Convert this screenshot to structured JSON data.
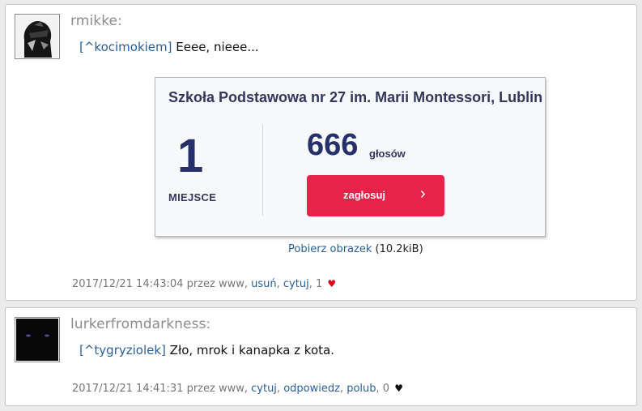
{
  "posts": [
    {
      "username": "rmikke:",
      "text_link": "[^kocimokiem]",
      "text": " Eeee, nieee...",
      "card": {
        "title": "Szkoła Podstawowa nr 27 im. Marii Montessori, Lublin",
        "rank": "1",
        "rank_label": "MIEJSCE",
        "votes": "666",
        "votes_label": "głosów",
        "button_label": "zagłosuj",
        "accent": "#e8234a"
      },
      "download_link": "Pobierz obrazek",
      "download_size": " (10.2kiB)",
      "meta_prefix": "2017/12/21 14:43:04 przez www, ",
      "actions": [
        "usuń",
        "cytuj"
      ],
      "likes": "1",
      "heart_color": "#e0001b"
    },
    {
      "username": "lurkerfromdarkness:",
      "text_link": "[^tygryziolek]",
      "text": " Zło, mrok i kanapka z kota.",
      "meta_prefix": "2017/12/21 14:41:31 przez www, ",
      "actions": [
        "cytuj",
        "odpowiedz",
        "polub"
      ],
      "likes": "0",
      "heart_color": "#111111"
    }
  ]
}
